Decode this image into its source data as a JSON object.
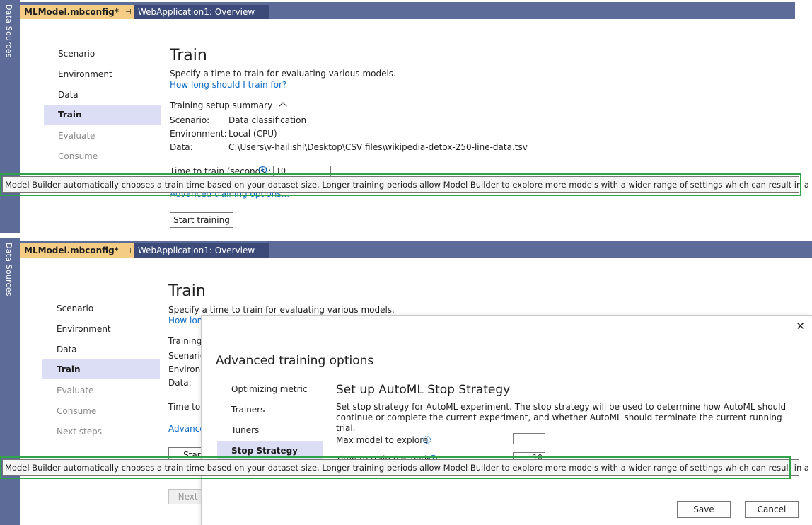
{
  "sidebar": {
    "label": "Data Sources"
  },
  "tabs": {
    "active": "MLModel.mbconfig*",
    "pin": "⊣",
    "close": "✕",
    "inactive": "WebApplication1: Overview"
  },
  "nav": {
    "top": [
      "Scenario",
      "Environment",
      "Data",
      "Train",
      "Evaluate",
      "Consume"
    ],
    "bottom": [
      "Scenario",
      "Environment",
      "Data",
      "Train",
      "Evaluate",
      "Consume",
      "Next steps"
    ],
    "selected": "Train"
  },
  "train": {
    "title": "Train",
    "description": "Specify a time to train for evaluating various models.",
    "help_link": "How long should I train for?",
    "help_link_partial": "How lon",
    "summary_label": "Training setup summary",
    "summary_label_partial": "Training s",
    "summary": {
      "scenario_label": "Scenario:",
      "scenario_label_partial": "Scenario:",
      "scenario_value": "Data classification",
      "environment_label": "Environment:",
      "environment_label_partial": "Environm",
      "environment_value": "Local (CPU)",
      "data_label": "Data:",
      "data_value": "C:\\Users\\v-hailishi\\Desktop\\CSV files\\wikipedia-detox-250-line-data.tsv"
    },
    "time_label": "Time to train (seconds):",
    "time_label_partial": "Time to t",
    "time_value": "10",
    "advanced_link_partial_top": "Advanced training options...",
    "advanced_link_partial": "Advance",
    "start_button": "Start training",
    "start_button_partial": "Start t",
    "next_button_partial": "Next st"
  },
  "tooltip": {
    "text": "Model Builder automatically chooses a train time based on your dataset size. Longer training periods allow Model Builder to explore more models with a wider range of settings which can result in a better model."
  },
  "dialog": {
    "title": "Advanced training options",
    "close": "✕",
    "nav": [
      "Optimizing metric",
      "Trainers",
      "Tuners",
      "Stop Strategy"
    ],
    "selected": "Stop Strategy",
    "heading": "Set up AutoML Stop Strategy",
    "description": "Set stop strategy for AutoML experiment. The stop strategy will be used to determine how AutoML should continue or complete the current experiment, and whether AutoML should terminate the current  running trial.",
    "max_model_label": "Max model to explore",
    "max_model_value": "",
    "time_label": "Time to train (seconds):",
    "time_value": "10",
    "save": "Save",
    "cancel": "Cancel"
  },
  "colors": {
    "accent_tab": "#f5cc84",
    "chrome": "#5d6b99",
    "selection": "#dcdef5",
    "link": "#0e6cc4",
    "highlight": "#30a24a"
  }
}
